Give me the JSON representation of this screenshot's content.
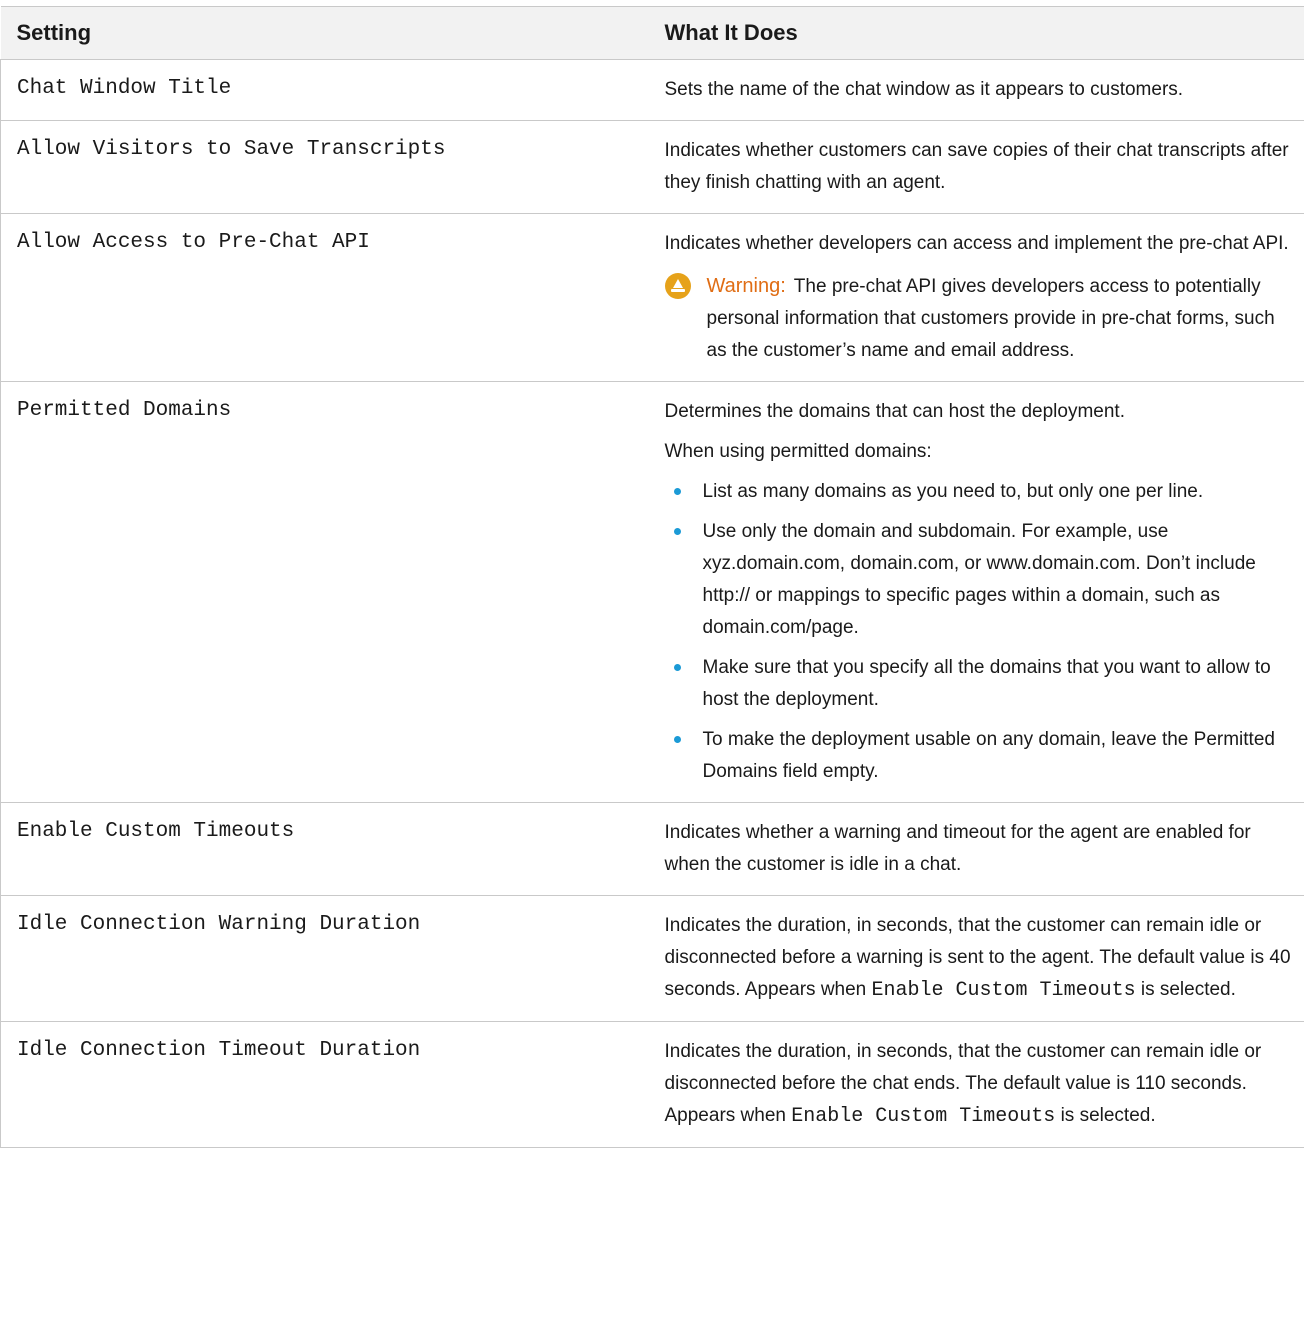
{
  "table": {
    "headers": {
      "setting": "Setting",
      "description": "What It Does"
    },
    "rows": {
      "chat_window_title": {
        "setting": "Chat Window Title",
        "description": "Sets the name of the chat window as it appears to customers."
      },
      "allow_save_transcripts": {
        "setting": "Allow Visitors to Save Transcripts",
        "description": "Indicates whether customers can save copies of their chat transcripts after they finish chatting with an agent."
      },
      "allow_prechat_api": {
        "setting": "Allow Access to Pre-Chat API",
        "description": "Indicates whether developers can access and implement the pre-chat API.",
        "warning_label": "Warning:",
        "warning_text": "The pre-chat API gives developers access to potentially personal information that customers provide in pre-chat forms, such as the customer’s name and email address.",
        "warning_icon": "warning-icon"
      },
      "permitted_domains": {
        "setting": "Permitted Domains",
        "description": "Determines the domains that can host the deployment.",
        "intro": "When using permitted domains:",
        "bullets": [
          "List as many domains as you need to, but only one per line.",
          "Use only the domain and subdomain. For example, use xyz.domain.com, domain.com, or www.domain.com. Don’t include http:// or mappings to specific pages within a domain, such as domain.com/page.",
          "Make sure that you specify all the domains that you want to allow to host the deployment.",
          "To make the deployment usable on any domain, leave the Permitted Domains field empty."
        ]
      },
      "enable_custom_timeouts": {
        "setting": "Enable Custom Timeouts",
        "description": "Indicates whether a warning and timeout for the agent are enabled for when the customer is idle in a chat."
      },
      "idle_warning_duration": {
        "setting": "Idle Connection Warning Duration",
        "description_before": "Indicates the duration, in seconds, that the customer can remain idle or disconnected before a warning is sent to the agent. The default value is 40 seconds. Appears when",
        "code": "Enable Custom Timeouts",
        "description_after": "is selected."
      },
      "idle_timeout_duration": {
        "setting": "Idle Connection Timeout Duration",
        "description_before": "Indicates the duration, in seconds, that the customer can remain idle or disconnected before the chat ends. The default value is 110 seconds. Appears when",
        "code": "Enable Custom Timeouts",
        "description_after": "is selected."
      }
    }
  },
  "colors": {
    "header_bg": "#f2f2f2",
    "border": "#c9c9c9",
    "warning_label": "#e06d14",
    "warning_icon": "#e6a21a",
    "bullet": "#1b9ad6"
  }
}
